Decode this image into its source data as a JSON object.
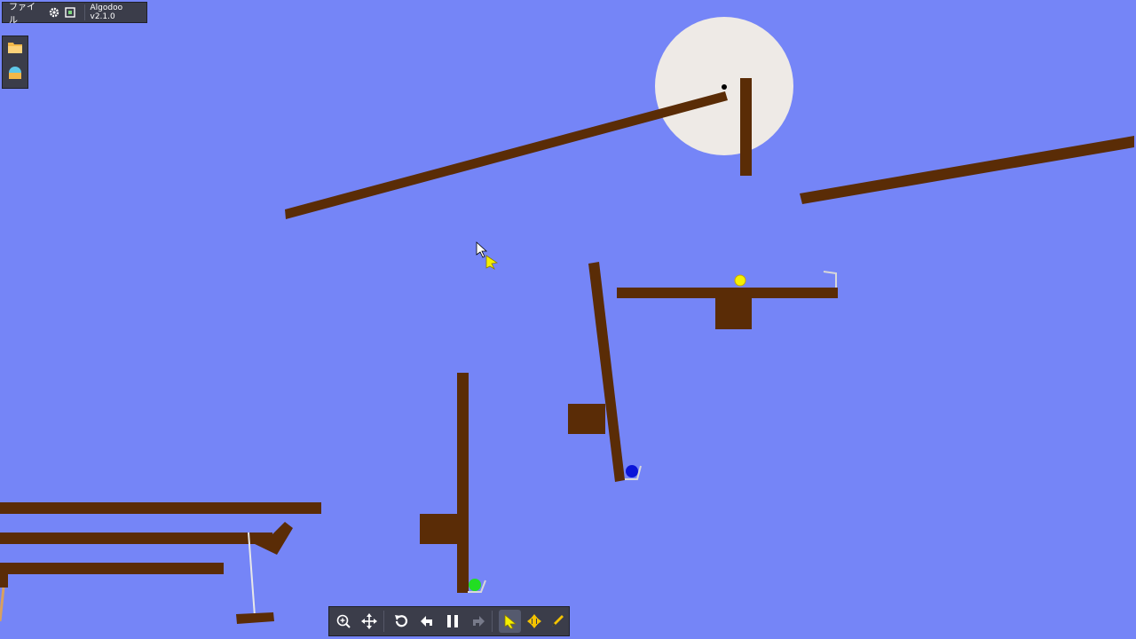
{
  "app": {
    "file_menu_label": "ファイル",
    "version_label": "Algodoo v2.1.0"
  },
  "topbar": {
    "settings_icon": "gear-icon",
    "scene_icon": "scene-icon"
  },
  "sidepanel": {
    "items": [
      {
        "name": "open-folder-icon"
      },
      {
        "name": "scene-browser-icon"
      }
    ]
  },
  "toolbar": {
    "tools": [
      {
        "name": "zoom-tool-icon",
        "active": false
      },
      {
        "name": "pan-tool-icon",
        "active": false
      },
      {
        "name": "reset-icon",
        "active": false
      },
      {
        "name": "undo-icon",
        "active": false
      },
      {
        "name": "pause-icon",
        "active": false
      },
      {
        "name": "redo-icon",
        "active": false
      },
      {
        "name": "drag-tool-icon",
        "active": true
      },
      {
        "name": "move-tool-icon",
        "active": false
      },
      {
        "name": "sketch-tool-icon",
        "active": false
      }
    ]
  },
  "colors": {
    "background": "#7585f7",
    "wood": "#5a2c06",
    "moon": "#eeeae6",
    "ball_yellow": "#f5f000",
    "ball_blue": "#0a14d8",
    "ball_green": "#22dd22",
    "toolbar": "#3b3d4a"
  }
}
